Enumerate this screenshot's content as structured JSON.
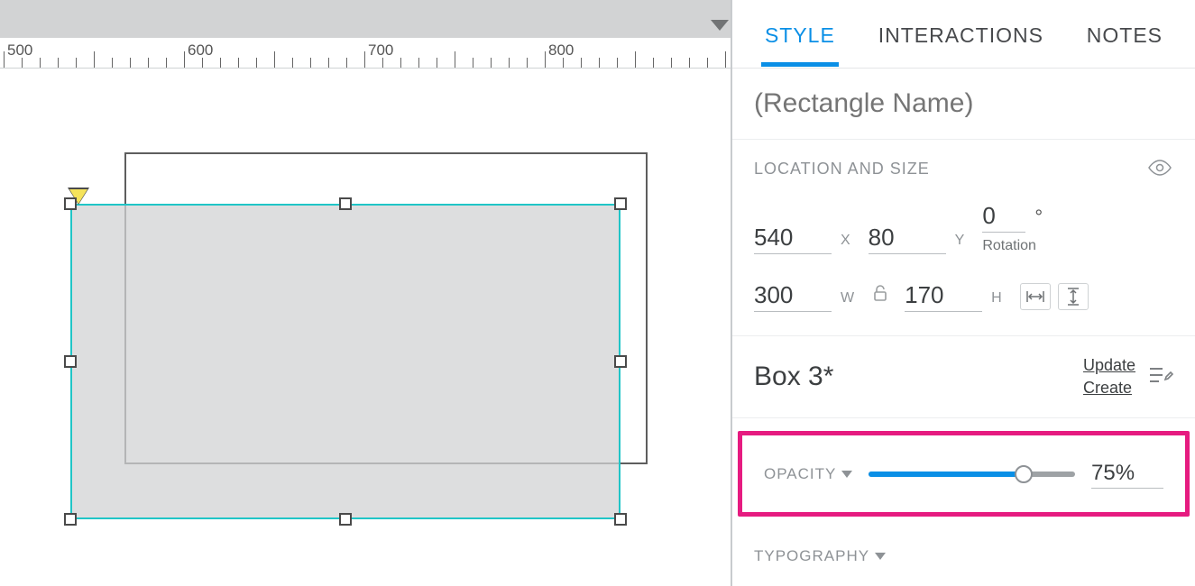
{
  "tabs": {
    "style": "STYLE",
    "interactions": "INTERACTIONS",
    "notes": "NOTES"
  },
  "name_placeholder": "(Rectangle Name)",
  "loc": {
    "label": "LOCATION AND SIZE",
    "x": "540",
    "xlab": "X",
    "y": "80",
    "ylab": "Y",
    "rot": "0",
    "rotlab": "Rotation",
    "w": "300",
    "wlab": "W",
    "h": "170",
    "hlab": "H"
  },
  "style_name": "Box 3*",
  "links": {
    "update": "Update",
    "create": "Create"
  },
  "opacity": {
    "label": "OPACITY",
    "value": "75%",
    "pct": 75
  },
  "typography": {
    "label": "TYPOGRAPHY"
  },
  "ruler": {
    "marks": [
      "500",
      "600",
      "700",
      "800"
    ]
  }
}
